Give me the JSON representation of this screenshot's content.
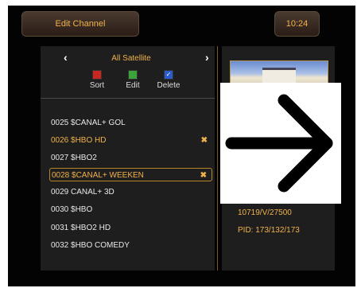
{
  "header": {
    "title": "Edit Channel",
    "clock": "10:24"
  },
  "nav": {
    "prev": "‹",
    "next": "›",
    "satellite": "All Satellite"
  },
  "options": [
    {
      "label": "Sort",
      "color": "#c8261f"
    },
    {
      "label": "Edit",
      "color": "#3ca23c"
    },
    {
      "label": "Delete",
      "color": "#2a5cd0"
    }
  ],
  "channels": [
    {
      "label": "0025 $CANAL+ GOL",
      "marked": false,
      "selected": false
    },
    {
      "label": "0026 $HBO HD",
      "marked": true,
      "selected": false
    },
    {
      "label": "0027 $HBO2",
      "marked": false,
      "selected": false
    },
    {
      "label": "0028 $CANAL+ WEEKEN",
      "marked": true,
      "selected": true
    },
    {
      "label": "0029 CANAL+ 3D",
      "marked": false,
      "selected": false
    },
    {
      "label": "0030 $HBO",
      "marked": false,
      "selected": false
    },
    {
      "label": "0031 $HBO2 HD",
      "marked": false,
      "selected": false
    },
    {
      "label": "0032 $HBO COMEDY",
      "marked": false,
      "selected": false
    }
  ],
  "mark_symbol": "✖",
  "details": {
    "transponder": "10719/V/27500",
    "pid": "PID: 173/132/173"
  },
  "colors": {
    "accent": "#f2b24a",
    "panel": "#1e1e1e",
    "background": "#030303"
  }
}
